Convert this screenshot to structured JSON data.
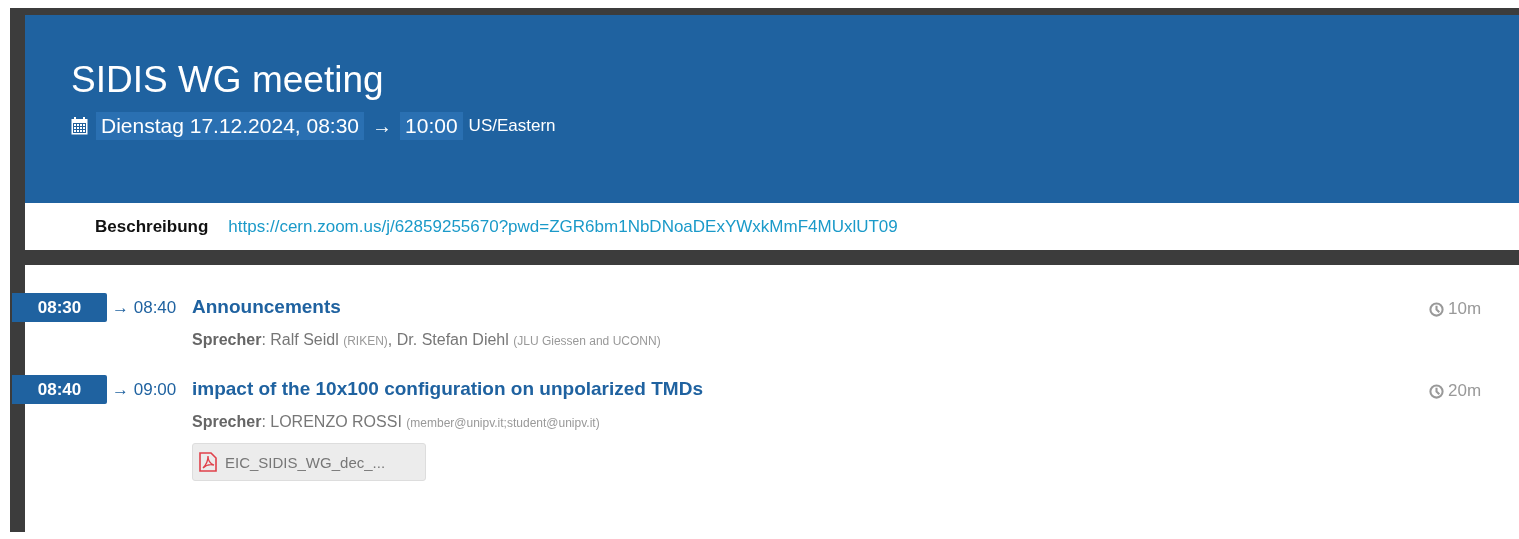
{
  "event": {
    "title": "SIDIS WG meeting",
    "start": "Dienstag 17.12.2024, 08:30",
    "arrow": "→",
    "end": "10:00",
    "timezone": "US/Eastern"
  },
  "description": {
    "label": "Beschreibung",
    "link": "https://cern.zoom.us/j/62859255670?pwd=ZGR6bm1NbDNoaDExYWxkMmF4MUxlUT09"
  },
  "contributions": [
    {
      "start": "08:30",
      "end": "→ 08:40",
      "title": "Announcements",
      "duration": "10m",
      "speaker_line": [
        {
          "kind": "label",
          "text": "Sprecher"
        },
        {
          "kind": "name",
          "text": ": Ralf Seidl "
        },
        {
          "kind": "affiliation",
          "text": "(RIKEN)"
        },
        {
          "kind": "name",
          "text": ", Dr. Stefan Diehl "
        },
        {
          "kind": "affiliation",
          "text": "(JLU Giessen and UCONN)"
        }
      ]
    },
    {
      "start": "08:40",
      "end": "→ 09:00",
      "title": "impact of the 10x100 configuration on unpolarized TMDs",
      "duration": "20m",
      "speaker_line": [
        {
          "kind": "label",
          "text": "Sprecher"
        },
        {
          "kind": "name",
          "text": ": LORENZO ROSSI "
        },
        {
          "kind": "affiliation",
          "text": "(member@unipv.it;student@unipv.it)"
        }
      ],
      "attachments": [
        {
          "kind": "pdf",
          "label": "EIC_SIDIS_WG_dec_..."
        }
      ]
    }
  ]
}
